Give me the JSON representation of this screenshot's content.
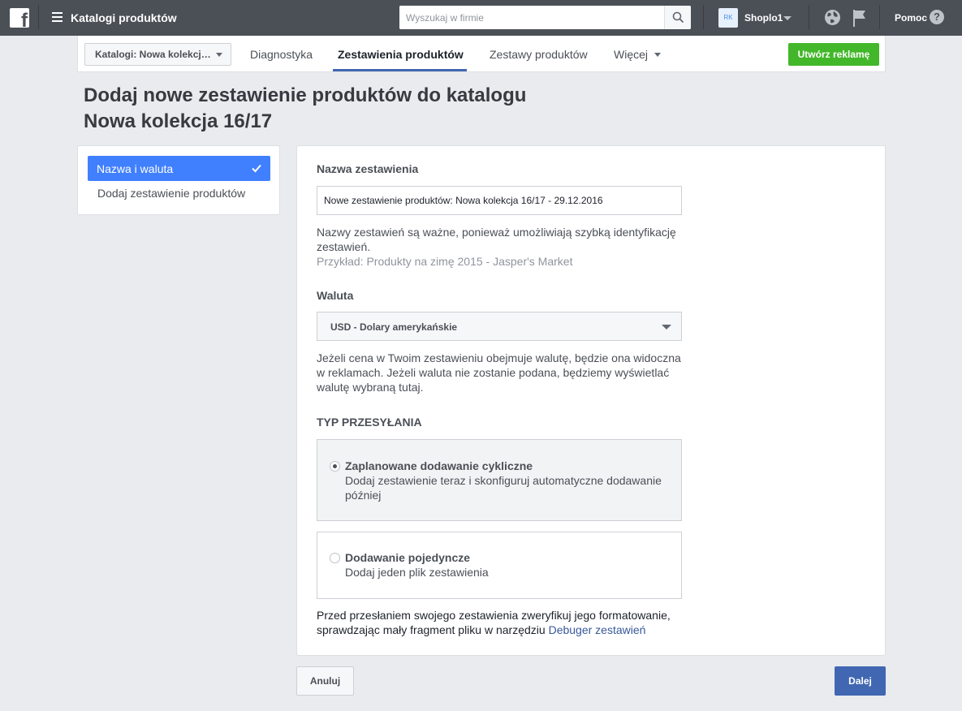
{
  "topbar": {
    "app_title": "Katalogi produktów",
    "search_placeholder": "Wyszukaj w firmie",
    "account_initials": "RK",
    "account_name": "Shoplo1",
    "help_label": "Pomoc",
    "icons": [
      "facebook-logo",
      "menu-icon",
      "search-icon",
      "globe-icon",
      "flag-icon",
      "help-icon"
    ]
  },
  "subnav": {
    "catalog_dropdown": "Katalogi: Nowa kolekcj…",
    "tabs": [
      {
        "label": "Diagnostyka",
        "active": false
      },
      {
        "label": "Zestawienia produktów",
        "active": true
      },
      {
        "label": "Zestawy produktów",
        "active": false
      },
      {
        "label": "Więcej",
        "active": false
      }
    ],
    "create_ad_label": "Utwórz reklamę"
  },
  "page": {
    "title_line1": "Dodaj nowe zestawienie produktów do katalogu",
    "title_line2": "Nowa kolekcja 16/17"
  },
  "steps": [
    {
      "label": "Nazwa i waluta",
      "active": true,
      "completed": true
    },
    {
      "label": "Dodaj zestawienie produktów",
      "active": false
    }
  ],
  "form": {
    "name_label": "Nazwa zestawienia",
    "name_value": "Nowe zestawienie produktów: Nowa kolekcja 16/17 - 29.12.2016",
    "name_help": "Nazwy zestawień są ważne, ponieważ umożliwiają szybką identyfikację zestawień.",
    "name_example": "Przykład: Produkty na zimę 2015 - Jasper's Market",
    "currency_label": "Waluta",
    "currency_value": "USD - Dolary amerykańskie",
    "currency_help": "Jeżeli cena w Twoim zestawieniu obejmuje walutę, będzie ona widoczna w reklamach. Jeżeli waluta nie zostanie podana, będziemy wyświetlać walutę wybraną tutaj.",
    "upload_type_label": "TYP PRZESYŁANIA",
    "upload_options": [
      {
        "title": "Zaplanowane dodawanie cykliczne",
        "desc": "Dodaj zestawienie teraz i skonfiguruj automatyczne dodawanie później",
        "selected": true
      },
      {
        "title": "Dodawanie pojedyncze",
        "desc": "Dodaj jeden plik zestawienia",
        "selected": false
      }
    ],
    "footnote_text": "Przed przesłaniem swojego zestawienia zweryfikuj jego formatowanie, sprawdzając mały fragment pliku w narzędziu ",
    "footnote_link": "Debuger zestawień"
  },
  "actions": {
    "cancel_label": "Anuluj",
    "next_label": "Dalej"
  },
  "colors": {
    "topbar": "#4b4f56",
    "active_tab_underline": "#4267b2",
    "create_ad_button": "#42b72a",
    "active_step": "#4080ff",
    "next_button": "#4267b2",
    "link": "#365899"
  }
}
